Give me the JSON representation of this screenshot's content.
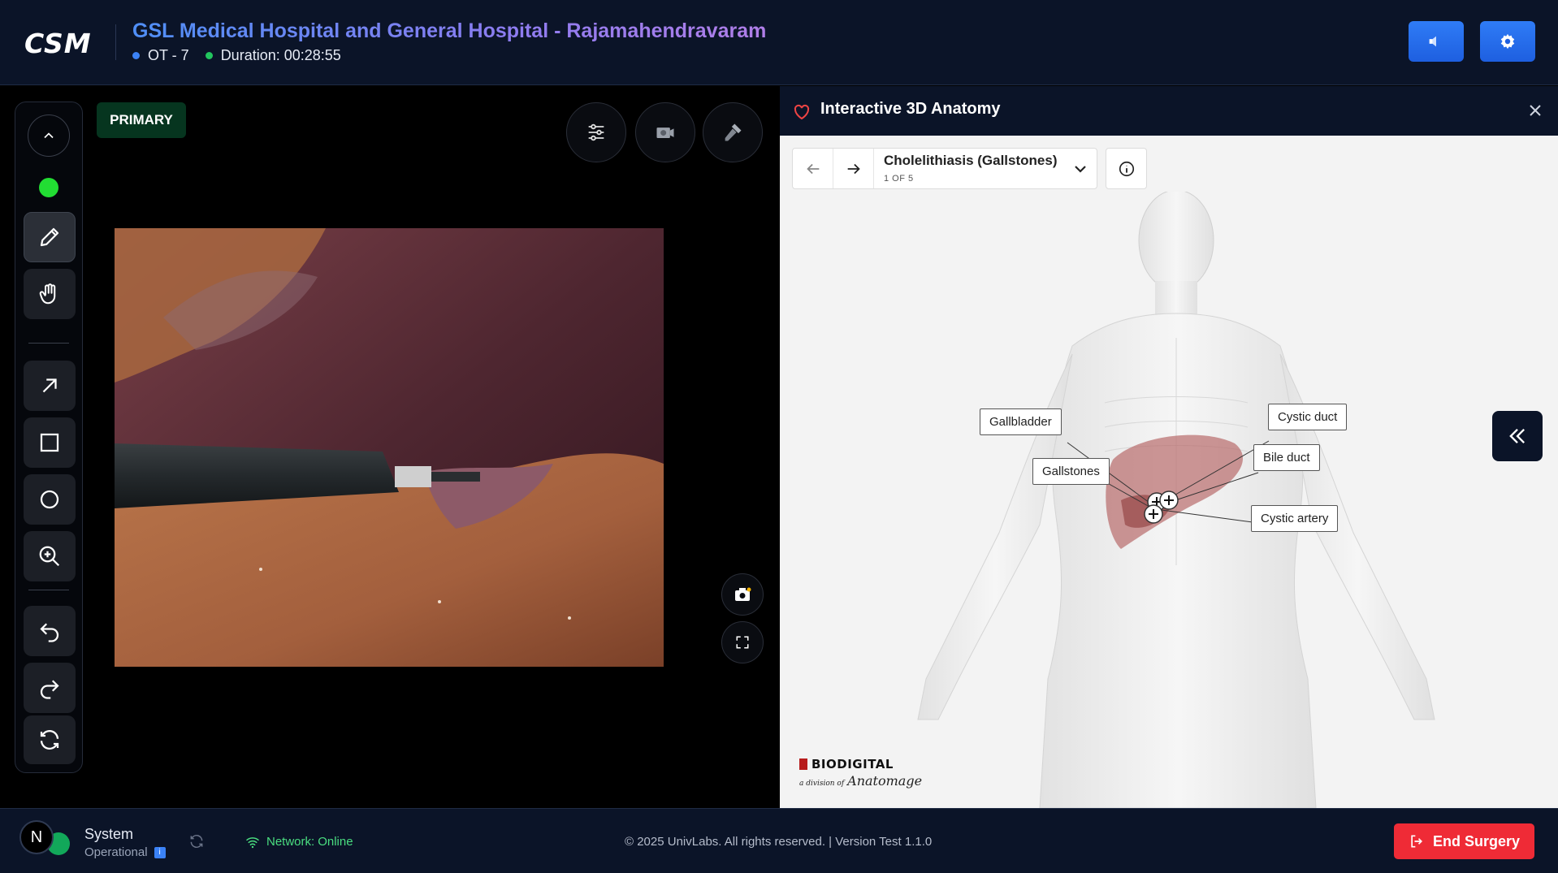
{
  "header": {
    "logo": "CSM",
    "hospital_name": "GSL Medical Hospital and General Hospital - Rajamahendravaram",
    "ot_label": "OT - 7",
    "duration_label": "Duration: 00:28:55",
    "icons": [
      "speaker-icon",
      "gear-icon"
    ],
    "accent_color": "#2f7cf6"
  },
  "video": {
    "feed_label": "PRIMARY",
    "status_color": "#22dd33",
    "controls": [
      "settings-sliders-icon",
      "camera-switch-icon",
      "microphone-icon"
    ],
    "corner_controls": [
      "screenshot-camera-icon",
      "fullscreen-icon"
    ]
  },
  "toolbar": {
    "tools": [
      "pencil-icon",
      "hand-icon",
      "arrow-icon",
      "rectangle-icon",
      "circle-icon",
      "zoom-in-icon",
      "undo-icon",
      "redo-icon",
      "refresh-icon"
    ]
  },
  "anatomy": {
    "panel_title": "Interactive 3D Anatomy",
    "condition_title": "Cholelithiasis (Gallstones)",
    "condition_count": "1 OF 5",
    "labels": {
      "gallbladder": "Gallbladder",
      "gallstones": "Gallstones",
      "cystic_duct": "Cystic duct",
      "bile_duct": "Bile duct",
      "cystic_artery": "Cystic artery"
    },
    "brand_name": "BIODIGITAL",
    "brand_sub_prefix": "a division of",
    "brand_sub_name": "Anatomage"
  },
  "footer": {
    "avatar_initial": "N",
    "system_title": "System",
    "system_status": "Operational",
    "network_label": "Network:",
    "network_status": "Online",
    "copyright": "© 2025 UnivLabs. All rights reserved. | Version Test 1.1.0",
    "end_button_label": "End Surgery",
    "end_button_color": "#ef2b36"
  }
}
